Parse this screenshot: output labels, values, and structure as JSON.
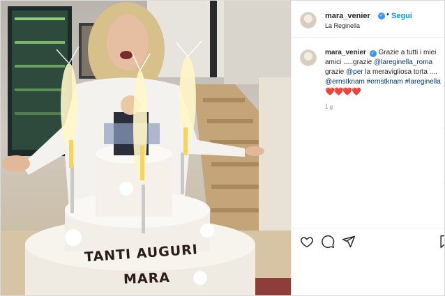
{
  "post": {
    "username": "mara_venier",
    "follow_separator": "•",
    "follow_label": "Segui",
    "location": "La Reginella"
  },
  "caption": {
    "username": "mara_venier",
    "part1": " Grazie a tutti i miei amici .....grazie ",
    "mention1": "@lareginella_roma",
    "part2": " grazie ",
    "mention2": "@per",
    "part3": " la meravigliosa torta .... ",
    "mention3": "@ernstknam",
    "hashtag1": "#ernstknam",
    "hashtag2": "#lareginella",
    "hearts": "❤️❤️❤️❤️",
    "time": "1 g"
  },
  "photo": {
    "cake_line1": "TANTI AUGURI",
    "cake_line2": "MARA"
  },
  "icons": [
    "verified-badge",
    "heart-icon",
    "comment-icon",
    "share-icon",
    "bookmark-icon"
  ],
  "colors": {
    "accent": "#0095f6",
    "link": "#00376b",
    "heart": "#ed4956",
    "muted": "#8e8e8e"
  }
}
